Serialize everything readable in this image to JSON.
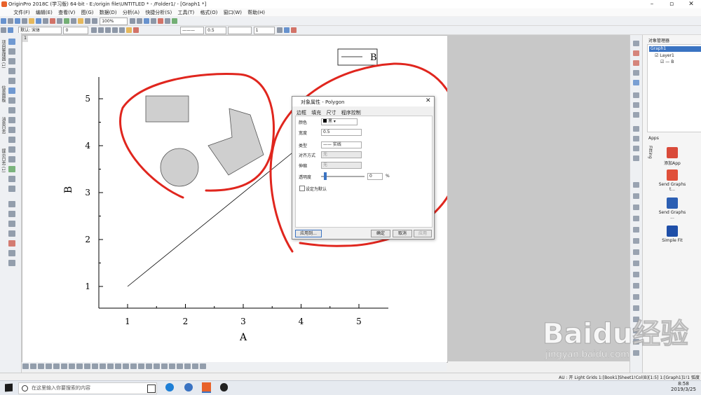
{
  "window": {
    "title": "OriginPro 2018C (学习版) 64-bit - E:/origin file\\UNTITLED * - /Folder1/ - [Graph1 *]"
  },
  "menu": [
    "文件(F)",
    "编辑(E)",
    "查看(V)",
    "图(G)",
    "数据(D)",
    "分析(A)",
    "快捷分析(S)",
    "工具(T)",
    "格式(O)",
    "窗口(W)",
    "帮助(H)"
  ],
  "toolbar": {
    "zoom": "100%",
    "font": "默认: 宋体",
    "font_size": "0",
    "line_width": "0.5",
    "line_num": "1"
  },
  "left_panels": [
    "项目管理器 (1)",
    "信息面板",
    "消息日志",
    "提示日志 (1)"
  ],
  "graph": {
    "tab": "1",
    "legend_label": "B",
    "x_label": "A",
    "y_label": "B",
    "x_ticks": [
      "1",
      "2",
      "3",
      "4",
      "5"
    ],
    "y_ticks": [
      "1",
      "2",
      "3",
      "4",
      "5"
    ]
  },
  "chart_data": {
    "type": "line",
    "x": [
      1,
      4
    ],
    "series": [
      {
        "name": "B",
        "values": [
          1,
          4
        ]
      }
    ],
    "xlabel": "A",
    "ylabel": "B",
    "xlim": [
      0.6,
      5.5
    ],
    "ylim": [
      0.6,
      5.5
    ],
    "legend": "top-right"
  },
  "dialog": {
    "title": "对象属性 - Polygon",
    "tabs": [
      "边框",
      "填充",
      "尺寸",
      "程序控制"
    ],
    "color_label": "颜色",
    "color_value": "黑",
    "width_label": "宽度",
    "width_value": "0.5",
    "type_label": "类型",
    "type_value": "—— 实线",
    "align_label": "对齐方式",
    "align_value": "无",
    "scale_label": "伸缩",
    "scale_value": "无",
    "transparency_label": "透明度",
    "transparency_value": "0",
    "transparency_unit": "%",
    "default_label": "设定为默认",
    "apply_button": "应用到...",
    "ok_button": "确定",
    "cancel_button": "取消",
    "apply_now_button": "应用"
  },
  "object_manager": {
    "title": "对象管理器",
    "graph": "Graph1",
    "layer": "Layer1",
    "plot": "B"
  },
  "apps": {
    "title": "Apps",
    "items": [
      "添加App",
      "Send Graphs t...",
      "Send Graphs ...",
      "Simple Fit"
    ],
    "fitting_tab": "Fitting"
  },
  "status": {
    "text": "AU : 开 Light Grids 1:[Book1]Sheet1!Col(B)[1:5] 1:[Graph1]1!1 弧度"
  },
  "taskbar": {
    "search_placeholder": "在这里输入你要搜索的内容",
    "time": "8:58",
    "date": "2019/3/25"
  },
  "watermark": {
    "brand": "Baidu经验",
    "url": "jingyan.baidu.com"
  },
  "colors": {
    "annotation": "#e0261e",
    "accent": "#3a73c2",
    "shape_fill": "#cfcfcf"
  }
}
